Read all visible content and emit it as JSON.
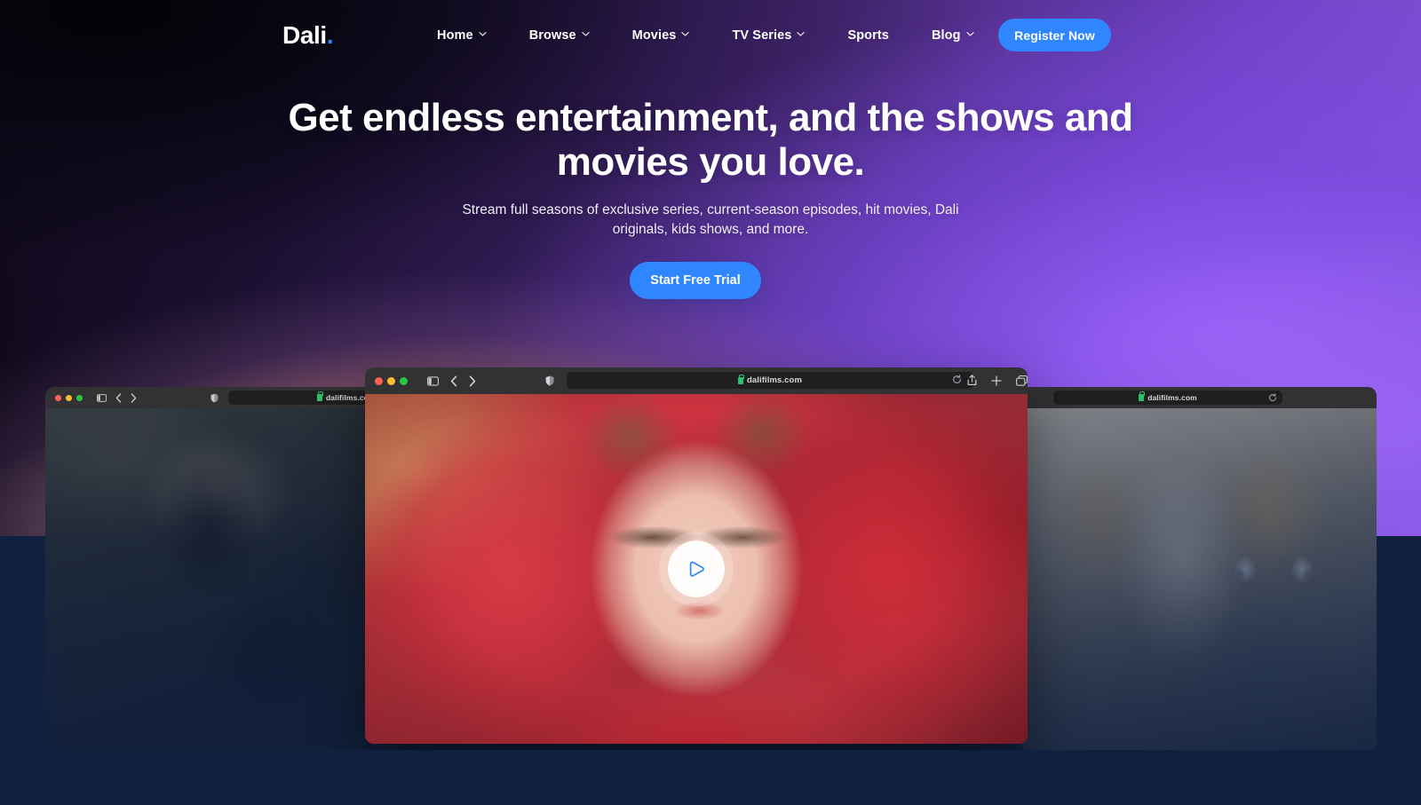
{
  "site": {
    "logo_text": "Dali",
    "logo_dot": ".",
    "accent_color": "#2f86ff",
    "background_navy": "#10203f"
  },
  "nav": {
    "items": [
      {
        "label": "Home",
        "has_dropdown": true,
        "icon": "chevron-down-icon"
      },
      {
        "label": "Browse",
        "has_dropdown": true,
        "icon": "chevron-down-icon"
      },
      {
        "label": "Movies",
        "has_dropdown": true,
        "icon": "chevron-down-icon"
      },
      {
        "label": "TV Series",
        "has_dropdown": true,
        "icon": "chevron-down-icon"
      },
      {
        "label": "Sports",
        "has_dropdown": false,
        "icon": ""
      },
      {
        "label": "Blog",
        "has_dropdown": true,
        "icon": "chevron-down-icon"
      }
    ],
    "register_label": "Register Now"
  },
  "hero": {
    "headline": "Get endless entertainment, and the shows and movies you love.",
    "subheadline": "Stream full seasons of exclusive series, current-season episodes, hit movies, Dali originals, kids shows, and more.",
    "cta_label": "Start Free Trial"
  },
  "browsers": {
    "left": {
      "url": "dalifilms.co",
      "icons": [
        "traffic-lights",
        "sidebar-icon",
        "back-icon",
        "forward-icon",
        "shield-icon",
        "lock-icon"
      ]
    },
    "main": {
      "url": "dalifilms.com",
      "icons": [
        "traffic-lights",
        "sidebar-icon",
        "back-icon",
        "forward-icon",
        "shield-icon",
        "lock-icon",
        "reload-icon",
        "share-icon",
        "new-tab-icon",
        "tab-overview-icon"
      ],
      "play_label": "play-icon"
    },
    "right": {
      "url": "dalifilms.com",
      "icons": [
        "lock-icon",
        "reload-icon"
      ]
    }
  }
}
